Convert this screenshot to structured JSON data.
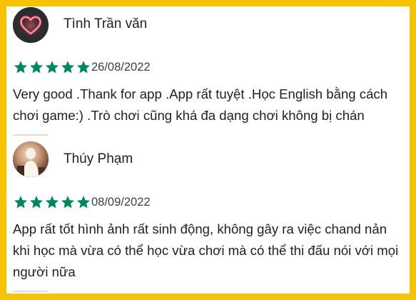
{
  "reviews": [
    {
      "author": "Tình Trần văn",
      "avatar_icon": "neon-heart-icon",
      "rating": 5,
      "date": "26/08/2022",
      "lines": [
        "Very good .Thank for app .App rất tuyệt .Học English bằng cách",
        "chơi game:) .Trò chơi cũng khá đa dạng chơi không bị chán"
      ]
    },
    {
      "author": "Thúy Phạm",
      "avatar_icon": "profile-photo",
      "rating": 5,
      "date": "08/09/2022",
      "lines": [
        "App rất tốt hình ảnh rất sinh động, không gây ra việc chand nản",
        "khi học mà vừa có thể học vừa chơi mà có thể thi đấu nói với mọi",
        "người nữa"
      ]
    }
  ],
  "colors": {
    "frame": "#f5c400",
    "star": "#01875f",
    "text": "#202124",
    "divider": "#dadce0"
  }
}
